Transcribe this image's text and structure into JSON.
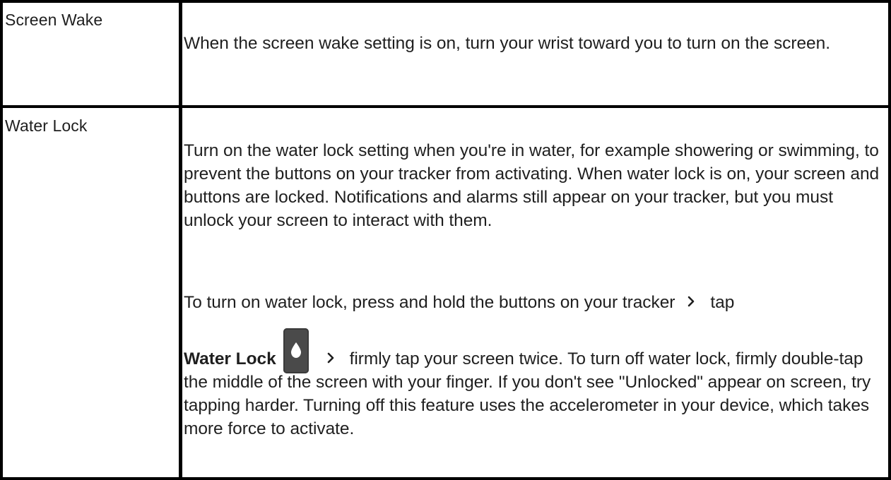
{
  "rows": [
    {
      "label": "Screen Wake",
      "text": "When the screen wake setting is on, turn your wrist toward you to turn on the screen."
    },
    {
      "label": "Water Lock",
      "text": "Turn on the water lock setting when you're in water, for example showering or swimming, to prevent the buttons on your tracker from activating. When water lock is on, your screen and buttons are locked. Notifications and alarms still appear on your tracker, but you must unlock your screen to interact with them.",
      "instructions": {
        "part1": "To turn on water lock, press and hold the buttons on your tracker",
        "part2": "tap",
        "bold_label": "Water Lock",
        "part3": "firmly tap your screen twice. To turn off water lock, firmly double-tap the middle of the screen with your finger. If you don't see \"Unlocked\" appear on screen, try tapping harder. Turning off this feature uses the accelerometer in your device, which takes more force to activate."
      }
    }
  ],
  "icons": {
    "chevron": "chevron-right-icon",
    "water": "water-drop-icon"
  },
  "colors": {
    "border": "#000000",
    "text": "#1f1f1f",
    "icon_bg": "#4a4a4a"
  }
}
